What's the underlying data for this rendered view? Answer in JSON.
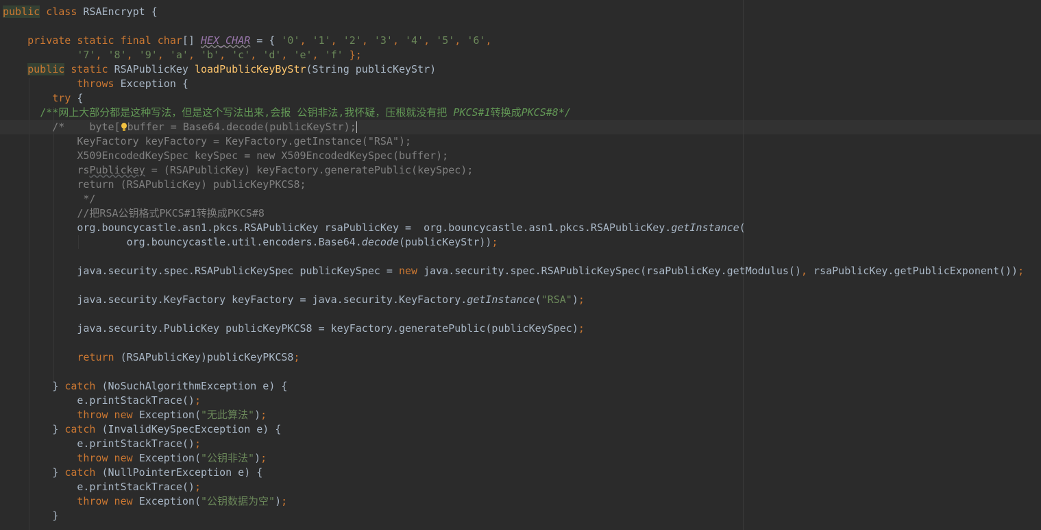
{
  "code_lines": [
    [
      "public",
      " class ",
      "RSAEncrypt",
      " {"
    ],
    [],
    [
      "    ",
      "private static final ",
      "char",
      "[] ",
      "HEX_CHAR",
      " = { ",
      "'0'",
      ", ",
      "'1'",
      ", ",
      "'2'",
      ", ",
      "'3'",
      ", ",
      "'4'",
      ", ",
      "'5'",
      ", ",
      "'6'",
      ","
    ],
    [
      "            ",
      "'7'",
      ", ",
      "'8'",
      ", ",
      "'9'",
      ", ",
      "'a'",
      ", ",
      "'b'",
      ", ",
      "'c'",
      ", ",
      "'d'",
      ", ",
      "'e'",
      ", ",
      "'f'",
      " };"
    ],
    [
      "    ",
      "public",
      " ",
      "static ",
      "RSAPublicKey ",
      "loadPublicKeyByStr",
      "(String publicKeyStr)"
    ],
    [
      "            ",
      "throws ",
      "Exception {"
    ],
    [
      "        ",
      "try ",
      "{"
    ],
    [
      "      ",
      "/**",
      "网上大部分都是这种写法，但是这个写法出来,会报 公钥非法,我怀疑，压根就没有把 ",
      "PKCS#1",
      "转换成",
      "PKCS#8",
      "*/"
    ],
    [
      "        /*    byte[",
      "",
      "buffer = Base64.decode(publicKeyStr);",
      ""
    ],
    [
      "            KeyFactory keyFactory = KeyFactory.getInstance(\"RSA\");"
    ],
    [
      "            X509EncodedKeySpec keySpec = new X509EncodedKeySpec(buffer);"
    ],
    [
      "            rs",
      "Publickey",
      " = (RSAPublicKey) keyFactory.generatePublic(keySpec);"
    ],
    [
      "            return (RSAPublicKey) publicKeyPKCS8;"
    ],
    [
      "             */"
    ],
    [
      "            //把RSA公钥格式PKCS#1转换成PKCS#8"
    ],
    [
      "            org.bouncycastle.asn1.pkcs.RSAPublicKey rsaPublicKey =  org.bouncycastle.asn1.pkcs.RSAPublicKey.",
      "getInstance",
      "("
    ],
    [
      "                    org.bouncycastle.util.encoders.Base64.",
      "decode",
      "(publicKeyStr))",
      ";"
    ],
    [],
    [
      "            java.security.spec.RSAPublicKeySpec publicKeySpec = ",
      "new ",
      "java.security.spec.RSAPublicKeySpec(rsaPublicKey.getModulus()",
      ", ",
      "rsaPublicKey.getPublicExponent())",
      ";"
    ],
    [],
    [
      "            java.security.KeyFactory keyFactory = java.security.KeyFactory.",
      "getInstance",
      "(",
      "\"RSA\"",
      ")",
      ";"
    ],
    [],
    [
      "            java.security.PublicKey publicKeyPKCS8 = keyFactory.generatePublic(publicKeySpec)",
      ";"
    ],
    [],
    [
      "            ",
      "return ",
      "(RSAPublicKey)publicKeyPKCS8",
      ";"
    ],
    [],
    [
      "        } ",
      "catch ",
      "(NoSuchAlgorithmException e) {"
    ],
    [
      "            e.printStackTrace()",
      ";"
    ],
    [
      "            ",
      "throw new ",
      "Exception(",
      "\"无此算法\"",
      ")",
      ";"
    ],
    [
      "        } ",
      "catch ",
      "(InvalidKeySpecException e) {"
    ],
    [
      "            e.printStackTrace()",
      ";"
    ],
    [
      "            ",
      "throw new ",
      "Exception(",
      "\"公钥非法\"",
      ")",
      ";"
    ],
    [
      "        } ",
      "catch ",
      "(NullPointerException e) {"
    ],
    [
      "            e.printStackTrace()",
      ";"
    ],
    [
      "            ",
      "throw new ",
      "Exception(",
      "\"公钥数据为空\"",
      ")",
      ";"
    ],
    [
      "        }"
    ]
  ],
  "colors": {
    "background": "#2b2b2b",
    "keyword": "#cc7832",
    "method": "#ffc66d",
    "string": "#6a8759",
    "comment": "#808080",
    "doc_comment": "#629755",
    "constant": "#9876aa",
    "text": "#a9b7c6"
  },
  "icons": [
    "lightbulb-icon"
  ]
}
